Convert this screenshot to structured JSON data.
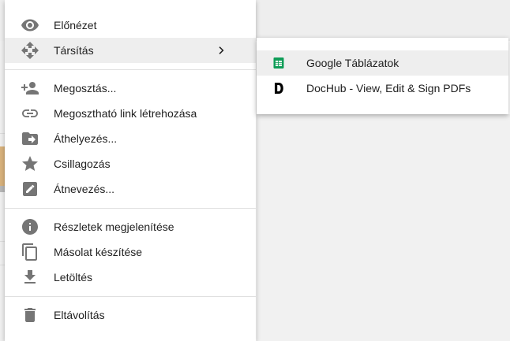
{
  "menu": {
    "items": [
      {
        "label": "Előnézet",
        "icon": "eye-icon"
      },
      {
        "label": "Társítás",
        "icon": "move-arrows-icon"
      },
      {
        "label": "Megosztás...",
        "icon": "person-add-icon"
      },
      {
        "label": "Megosztható link létrehozása",
        "icon": "link-icon"
      },
      {
        "label": "Áthelyezés...",
        "icon": "folder-move-icon"
      },
      {
        "label": "Csillagozás",
        "icon": "star-icon"
      },
      {
        "label": "Átnevezés...",
        "icon": "rename-icon"
      },
      {
        "label": "Részletek megjelenítése",
        "icon": "info-icon"
      },
      {
        "label": "Másolat készítése",
        "icon": "copy-icon"
      },
      {
        "label": "Letöltés",
        "icon": "download-icon"
      },
      {
        "label": "Eltávolítás",
        "icon": "trash-icon"
      }
    ]
  },
  "submenu": {
    "items": [
      {
        "label": "Google Táblázatok",
        "icon": "google-sheets-icon"
      },
      {
        "label": "DocHub - View, Edit & Sign PDFs",
        "icon": "dochub-icon"
      }
    ]
  },
  "colors": {
    "icon": "#757575",
    "text": "#212121",
    "hover": "#eeeeee",
    "sheets_green": "#0f9d58"
  }
}
